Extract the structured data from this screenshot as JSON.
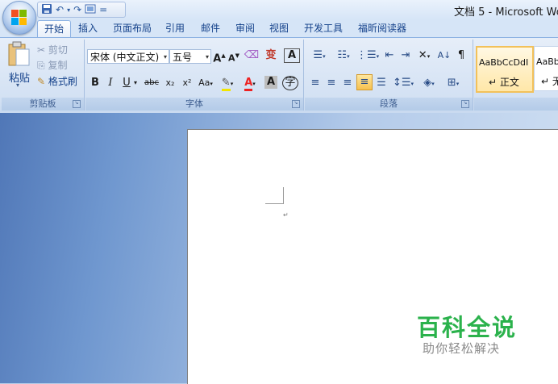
{
  "window": {
    "title": "文档 5 - Microsoft Wor"
  },
  "quick_access": {
    "save_icon": "save-icon",
    "undo_icon": "undo-icon",
    "redo_icon": "redo-icon",
    "print_preview_icon": "print-preview-icon",
    "customize": "="
  },
  "tabs": [
    "开始",
    "插入",
    "页面布局",
    "引用",
    "邮件",
    "审阅",
    "视图",
    "开发工具",
    "福昕阅读器"
  ],
  "active_tab": 0,
  "clipboard": {
    "paste": "粘贴",
    "cut": "剪切",
    "copy": "复制",
    "format_painter": "格式刷",
    "label": "剪贴板"
  },
  "font": {
    "name": "宋体 (中文正文)",
    "size": "五号",
    "label": "字体",
    "buttons": {
      "bold": "B",
      "italic": "I",
      "underline": "U",
      "strike": "abc",
      "subscript": "x₂",
      "superscript": "x²",
      "case": "Aa",
      "grow": "A",
      "shrink": "A",
      "pinyin": "变",
      "border": "A",
      "char_shade": "A",
      "enclose": "字"
    }
  },
  "paragraph": {
    "label": "段落"
  },
  "styles": [
    {
      "sample": "AaBbCcDdI",
      "name": "↵ 正文"
    },
    {
      "sample": "AaBb",
      "name": "↵ 无"
    }
  ],
  "watermark": {
    "title": "百科全说",
    "subtitle": "助你轻松解决"
  },
  "colors": {
    "accent": "#15428b",
    "ribbon": "#d3e1f3",
    "watermark_green": "#2bb24c"
  }
}
